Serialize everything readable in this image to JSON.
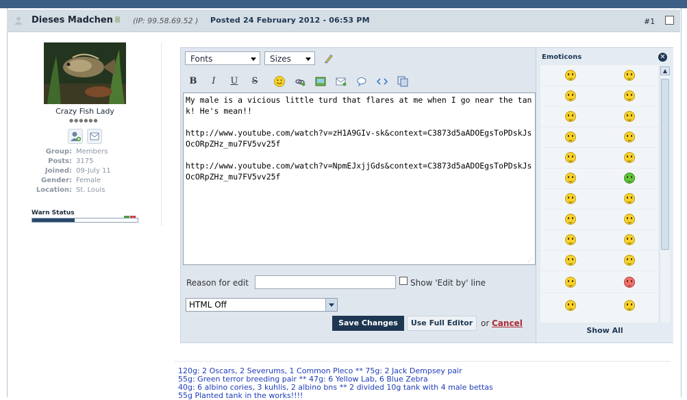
{
  "post": {
    "author": "Dieses Madchen",
    "ip": "(IP: 99.58.69.52 )",
    "posted": "Posted 24 February 2012 - 06:53 PM",
    "number": "#1"
  },
  "user": {
    "title": "Crazy Fish Lady",
    "pips": "●●●●●●",
    "info": [
      {
        "key": "Group:",
        "value": "Members"
      },
      {
        "key": "Posts:",
        "value": "3175"
      },
      {
        "key": "Joined:",
        "value": "09-July 11"
      },
      {
        "key": "Gender:",
        "value": "Female"
      },
      {
        "key": "Location:",
        "value": "St. Louis"
      }
    ],
    "warn_label": "Warn Status",
    "warn_level": 0.4
  },
  "editor": {
    "fonts_label": "Fonts",
    "sizes_label": "Sizes",
    "content": "My male is a vicious little turd that flares at me when I go near the tank! He's mean!!\n\nhttp://www.youtube.com/watch?v=zH1A9GIv-sk&context=C3873d5aADOEgsToPDskJsOcORpZHz_mu7FV5vv25f\n\nhttp://www.youtube.com/watch?v=NpmEJxjjGds&context=C3873d5aADOEgsToPDskJsOcORpZHz_mu7FV5vv25f",
    "reason_label": "Reason for edit",
    "reason_value": "",
    "show_edit_by": "Show 'Edit by' line",
    "html_mode": "HTML Off",
    "save_label": "Save Changes",
    "full_editor_label": "Use Full Editor",
    "or_text": "or",
    "cancel_label": "Cancel"
  },
  "toolbar": {
    "bold": "B",
    "italic": "I",
    "underline": "U",
    "strike": "S"
  },
  "emoticons": {
    "title": "Emoticons",
    "show_all": "Show All"
  },
  "signature": [
    "120g: 2 Oscars, 2 Severums, 1 Common Pleco ** 75g: 2 Jack Dempsey pair",
    "55g: Green terror breeding pair ** 47g: 6 Yellow Lab, 6 Blue Zebra",
    "40g: 6 albino cories, 3 kuhlis, 2 albino bns ** 2 divided 10g tank with 4 male bettas",
    "55g Planted tank in the works!!!!"
  ]
}
